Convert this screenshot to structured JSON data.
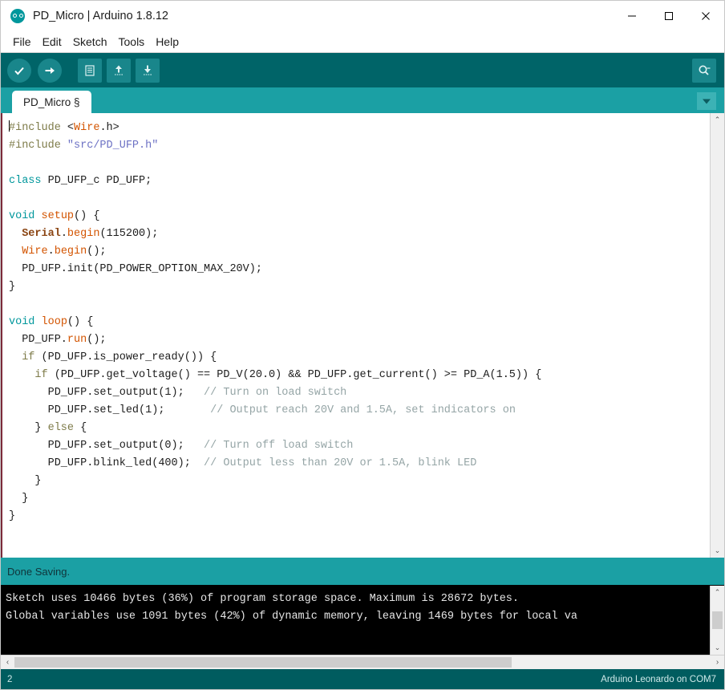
{
  "window": {
    "title": "PD_Micro | Arduino 1.8.12",
    "app_icon": "arduino-logo-icon",
    "controls": {
      "minimize": "–",
      "maximize": "☐",
      "close": "✕"
    }
  },
  "menubar": {
    "items": [
      {
        "label": "File"
      },
      {
        "label": "Edit"
      },
      {
        "label": "Sketch"
      },
      {
        "label": "Tools"
      },
      {
        "label": "Help"
      }
    ]
  },
  "toolbar": {
    "verify_label": "✔",
    "upload_label": "→",
    "new_label": "▤",
    "open_label": "↑",
    "save_label": "↓",
    "serial_monitor_label": "⌕"
  },
  "tabs": {
    "active": "PD_Micro §",
    "menu_label": "▼"
  },
  "editor": {
    "lines": [
      {
        "id": 1,
        "segs": [
          {
            "t": "#include ",
            "c": "pre"
          },
          {
            "t": "<",
            "c": "plain"
          },
          {
            "t": "Wire",
            "c": "lib"
          },
          {
            "t": ".h>",
            "c": "plain"
          }
        ]
      },
      {
        "id": 2,
        "segs": [
          {
            "t": "#include ",
            "c": "pre"
          },
          {
            "t": "\"src/PD_UFP.h\"",
            "c": "str"
          }
        ]
      },
      {
        "id": 3,
        "segs": []
      },
      {
        "id": 4,
        "segs": [
          {
            "t": "class",
            "c": "kw"
          },
          {
            "t": " PD_UFP_c PD_UFP;",
            "c": "plain"
          }
        ]
      },
      {
        "id": 5,
        "segs": []
      },
      {
        "id": 6,
        "segs": [
          {
            "t": "void",
            "c": "kw"
          },
          {
            "t": " ",
            "c": "plain"
          },
          {
            "t": "setup",
            "c": "fn"
          },
          {
            "t": "() {",
            "c": "plain"
          }
        ]
      },
      {
        "id": 7,
        "segs": [
          {
            "t": "  ",
            "c": "plain"
          },
          {
            "t": "Serial",
            "c": "libb"
          },
          {
            "t": ".",
            "c": "plain"
          },
          {
            "t": "begin",
            "c": "fn"
          },
          {
            "t": "(115200);",
            "c": "plain"
          }
        ]
      },
      {
        "id": 8,
        "segs": [
          {
            "t": "  ",
            "c": "plain"
          },
          {
            "t": "Wire",
            "c": "lib"
          },
          {
            "t": ".",
            "c": "plain"
          },
          {
            "t": "begin",
            "c": "fn"
          },
          {
            "t": "();",
            "c": "plain"
          }
        ]
      },
      {
        "id": 9,
        "segs": [
          {
            "t": "  PD_UFP.init(PD_POWER_OPTION_MAX_20V);",
            "c": "plain"
          }
        ]
      },
      {
        "id": 10,
        "segs": [
          {
            "t": "}",
            "c": "plain"
          }
        ]
      },
      {
        "id": 11,
        "segs": []
      },
      {
        "id": 12,
        "segs": [
          {
            "t": "void",
            "c": "kw"
          },
          {
            "t": " ",
            "c": "plain"
          },
          {
            "t": "loop",
            "c": "fn"
          },
          {
            "t": "() {",
            "c": "plain"
          }
        ]
      },
      {
        "id": 13,
        "segs": [
          {
            "t": "  PD_UFP.",
            "c": "plain"
          },
          {
            "t": "run",
            "c": "fn"
          },
          {
            "t": "();",
            "c": "plain"
          }
        ]
      },
      {
        "id": 14,
        "segs": [
          {
            "t": "  ",
            "c": "plain"
          },
          {
            "t": "if",
            "c": "pre"
          },
          {
            "t": " (PD_UFP.is_power_ready()) {",
            "c": "plain"
          }
        ]
      },
      {
        "id": 15,
        "segs": [
          {
            "t": "    ",
            "c": "plain"
          },
          {
            "t": "if",
            "c": "pre"
          },
          {
            "t": " (PD_UFP.get_voltage() == PD_V(20.0) && PD_UFP.get_current() >= PD_A(1.5)) {",
            "c": "plain"
          }
        ]
      },
      {
        "id": 16,
        "segs": [
          {
            "t": "      PD_UFP.set_output(1);   ",
            "c": "plain"
          },
          {
            "t": "// Turn on load switch",
            "c": "cmt"
          }
        ]
      },
      {
        "id": 17,
        "segs": [
          {
            "t": "      PD_UFP.set_led(1);       ",
            "c": "plain"
          },
          {
            "t": "// Output reach 20V and 1.5A, set indicators on",
            "c": "cmt"
          }
        ]
      },
      {
        "id": 18,
        "segs": [
          {
            "t": "    } ",
            "c": "plain"
          },
          {
            "t": "else",
            "c": "pre"
          },
          {
            "t": " {",
            "c": "plain"
          }
        ]
      },
      {
        "id": 19,
        "segs": [
          {
            "t": "      PD_UFP.set_output(0);   ",
            "c": "plain"
          },
          {
            "t": "// Turn off load switch",
            "c": "cmt"
          }
        ]
      },
      {
        "id": 20,
        "segs": [
          {
            "t": "      PD_UFP.blink_led(400);  ",
            "c": "plain"
          },
          {
            "t": "// Output less than 20V or 1.5A, blink LED",
            "c": "cmt"
          }
        ]
      },
      {
        "id": 21,
        "segs": [
          {
            "t": "    }",
            "c": "plain"
          }
        ]
      },
      {
        "id": 22,
        "segs": [
          {
            "t": "  }",
            "c": "plain"
          }
        ]
      },
      {
        "id": 23,
        "segs": [
          {
            "t": "}",
            "c": "plain"
          }
        ]
      }
    ]
  },
  "status": {
    "message": "Done Saving."
  },
  "console": {
    "lines": [
      "Sketch uses 10466 bytes (36%) of program storage space. Maximum is 28672 bytes.",
      "Global variables use 1091 bytes (42%) of dynamic memory, leaving 1469 bytes for local va"
    ]
  },
  "scrollbars": {
    "up_arrow": "⌃",
    "down_arrow": "⌄",
    "left_arrow": "‹",
    "right_arrow": "›"
  },
  "bottombar": {
    "line_number": "2",
    "board_info": "Arduino Leonardo on COM7"
  },
  "colors": {
    "toolbar_bg": "#006468",
    "tabbar_bg": "#1ba0a4",
    "bottombar_bg": "#005c5f",
    "console_bg": "#000000",
    "accent": "#00979c"
  }
}
